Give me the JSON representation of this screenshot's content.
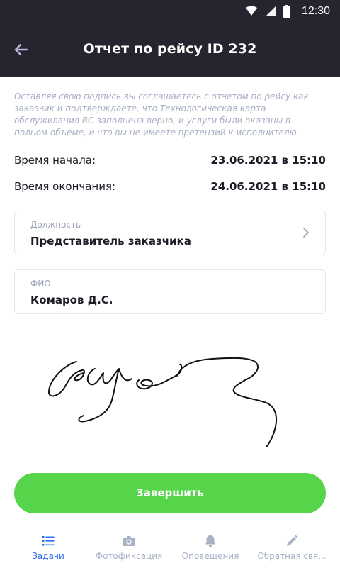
{
  "status_bar": {
    "time": "12:30"
  },
  "header": {
    "title": "Отчет по рейсу ID 232"
  },
  "disclaimer": "Оставляя свою подпись вы соглашаетесь с отчетом по рейсу как заказчик и подтверждаете, что Технологическая карта обслуживания ВС заполнена верно, и услуги были оказаны в полном объеме, и что вы не имеете претензий к исполнителю",
  "times": {
    "start_label": "Время начала:",
    "start_value": "23.06.2021 в 15:10",
    "end_label": "Время окончания:",
    "end_value": "24.06.2021 в 15:10"
  },
  "position_field": {
    "label": "Должность",
    "value": "Представитель заказчика"
  },
  "name_field": {
    "label": "ФИО",
    "value": "Комаров Д.С."
  },
  "finish_button": "Завершить",
  "tabs": [
    {
      "label": "Задачи",
      "icon": "list-icon",
      "active": true
    },
    {
      "label": "Фотофиксация",
      "icon": "camera-icon",
      "active": false
    },
    {
      "label": "Оповещения",
      "icon": "bell-icon",
      "active": false
    },
    {
      "label": "Обратная свя...",
      "icon": "pencil-icon",
      "active": false
    }
  ],
  "colors": {
    "header_bg": "#27242f",
    "accent_green": "#56d54b",
    "active_tab": "#2f6bf0",
    "muted_text": "#a9b1c5"
  }
}
